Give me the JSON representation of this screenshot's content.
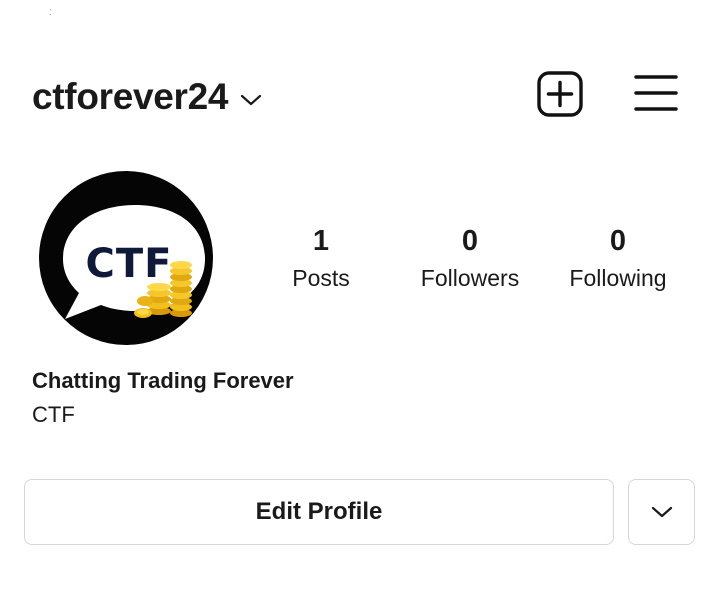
{
  "header": {
    "username": "ctforever24"
  },
  "avatar": {
    "logo_text": "CTF"
  },
  "stats": [
    {
      "count": "1",
      "label": "Posts"
    },
    {
      "count": "0",
      "label": "Followers"
    },
    {
      "count": "0",
      "label": "Following"
    }
  ],
  "profile": {
    "display_name": "Chatting Trading Forever",
    "bio": "CTF"
  },
  "actions": {
    "edit_profile_label": "Edit Profile"
  },
  "icons": {
    "username_dropdown": "chevron-down-icon",
    "new_post": "plus-square-icon",
    "menu": "hamburger-menu-icon",
    "suggested": "chevron-down-icon"
  }
}
